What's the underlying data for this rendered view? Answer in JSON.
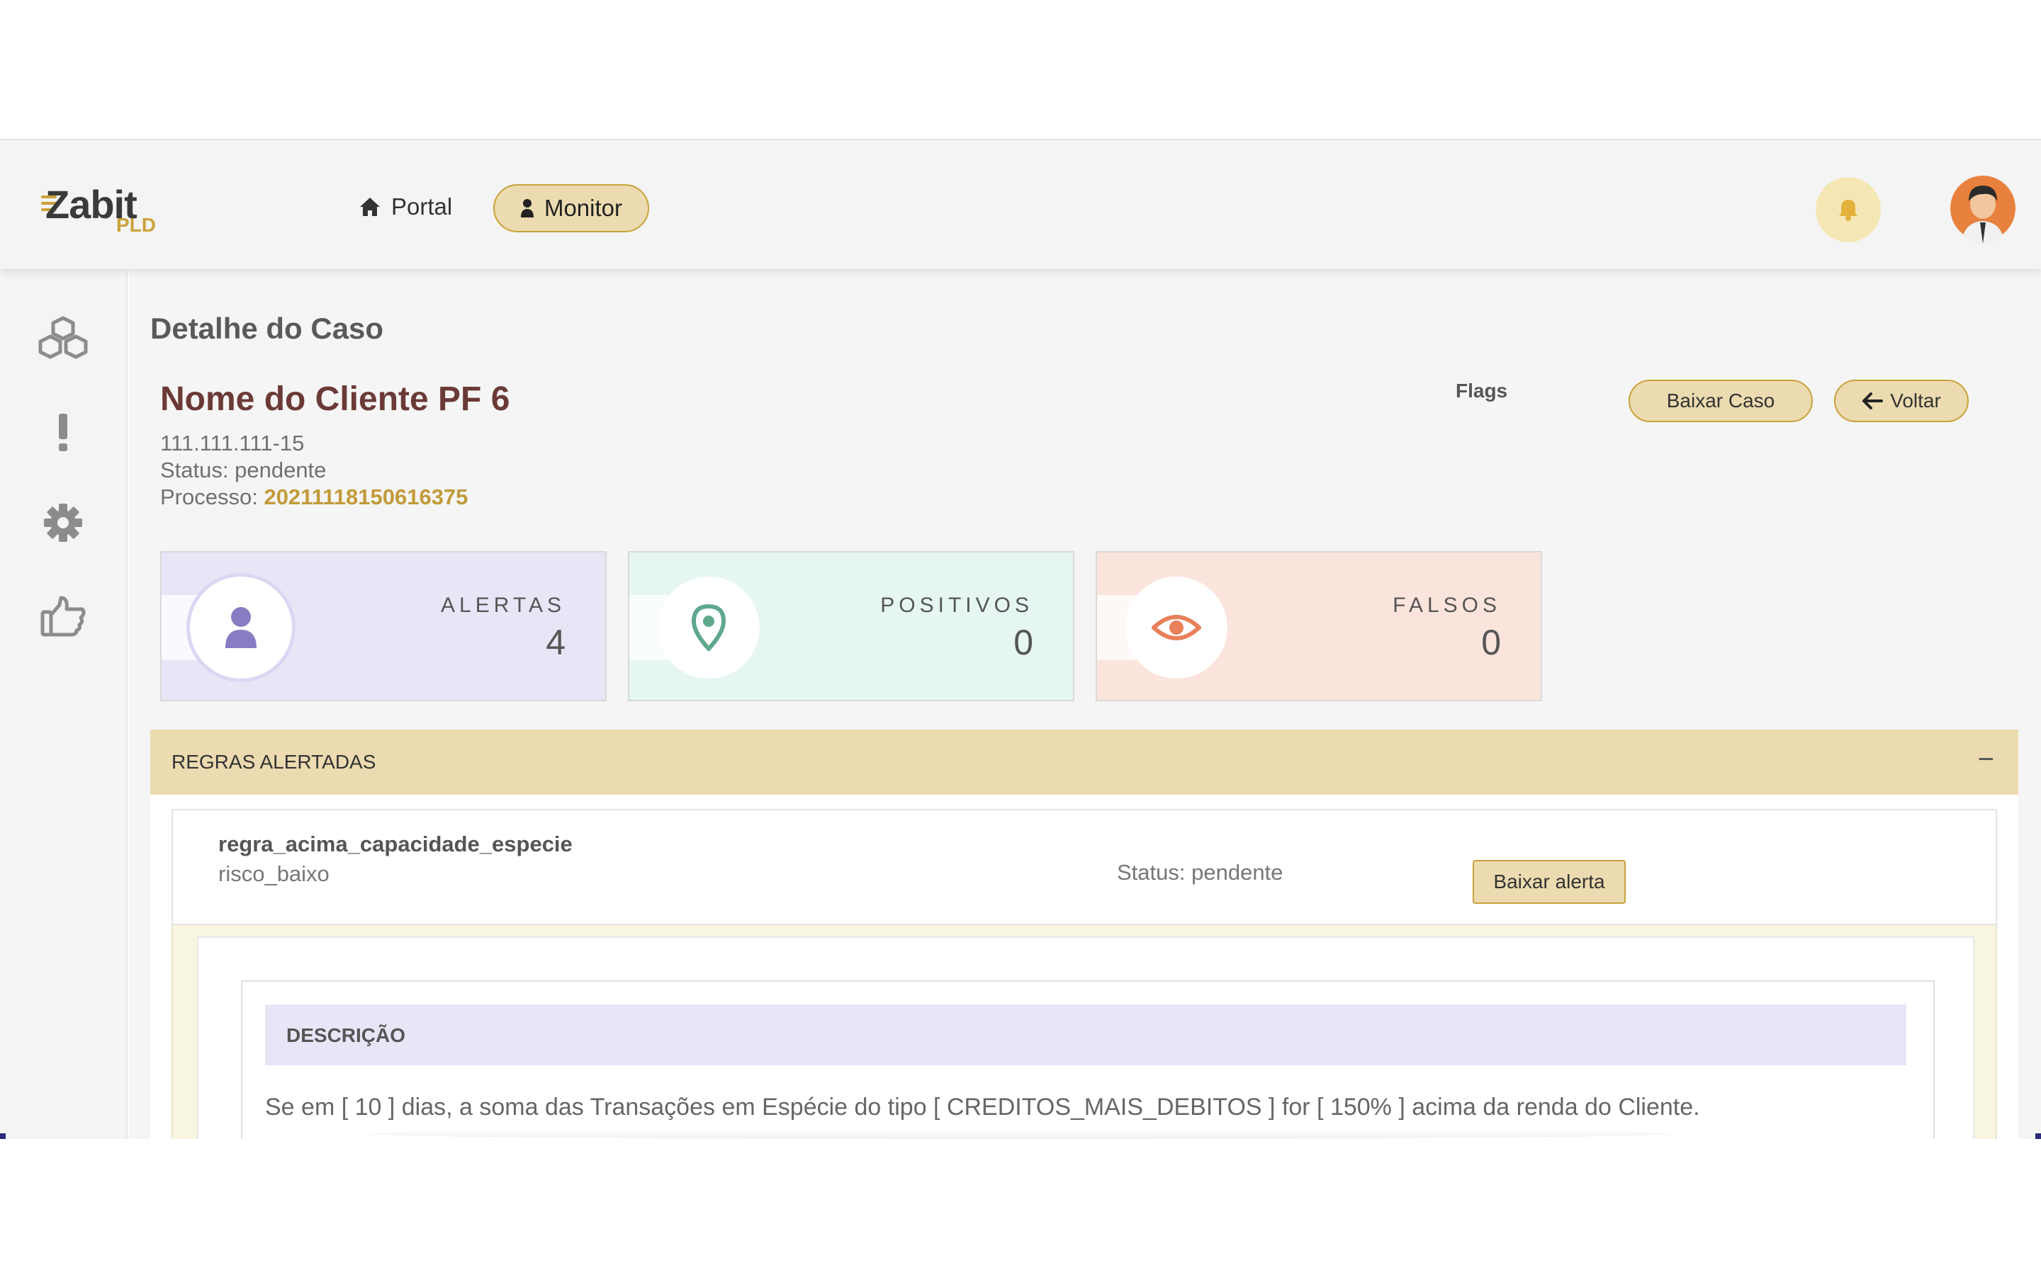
{
  "header": {
    "logo_main": "Zabit",
    "logo_sub": "PLD",
    "nav": [
      {
        "label": "Portal",
        "icon": "home-icon"
      },
      {
        "label": "Monitor",
        "icon": "user-icon",
        "active": true
      }
    ],
    "notification_icon": "bell-icon",
    "avatar_icon": "user-avatar"
  },
  "sidebar": {
    "items": [
      {
        "icon": "cubes-icon"
      },
      {
        "icon": "exclamation-icon"
      },
      {
        "icon": "gear-icon"
      },
      {
        "icon": "thumbs-up-icon"
      }
    ]
  },
  "page": {
    "title": "Detalhe do Caso",
    "client_name": "Nome do Cliente PF 6",
    "document": "111.111.111-15",
    "status": "Status: pendente",
    "process_label": "Processo: ",
    "process_value": "20211118150616375",
    "flags_label": "Flags",
    "download_case_label": "Baixar Caso",
    "back_label": "Voltar"
  },
  "stats": {
    "alertas": {
      "label": "ALERTAS",
      "value": "4",
      "icon": "user-icon",
      "color": "#8a7cc2"
    },
    "positivos": {
      "label": "POSITIVOS",
      "value": "0",
      "icon": "map-pin-icon",
      "color": "#5fa88c"
    },
    "falsos": {
      "label": "FALSOS",
      "value": "0",
      "icon": "eye-icon",
      "color": "#e8805a"
    }
  },
  "rules": {
    "title": "REGRAS ALERTADAS",
    "toggle": "−",
    "items": [
      {
        "name": "regra_acima_capacidade_especie",
        "risk": "risco_baixo",
        "status": "Status: pendente",
        "download_label": "Baixar alerta",
        "description_title": "DESCRIÇÃO",
        "description": "Se em [ 10 ] dias, a soma das Transações em Espécie do tipo [ CREDITOS_MAIS_DEBITOS ] for [ 150% ] acima da renda do Cliente."
      }
    ]
  },
  "colors": {
    "accent": "#c9a23a",
    "accent_light": "#ecdbb0",
    "client_name": "#6b3a36"
  }
}
